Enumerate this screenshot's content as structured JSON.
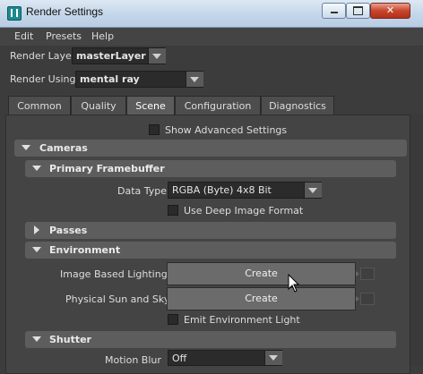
{
  "window": {
    "title": "Render Settings"
  },
  "menu": [
    "Edit",
    "Presets",
    "Help"
  ],
  "render_layer": {
    "label": "Render Layer",
    "value": "masterLayer"
  },
  "render_using": {
    "label": "Render Using",
    "value": "mental ray"
  },
  "tabs": [
    {
      "label": "Common",
      "active": false
    },
    {
      "label": "Quality",
      "active": false
    },
    {
      "label": "Scene",
      "active": true
    },
    {
      "label": "Configuration",
      "active": false
    },
    {
      "label": "Diagnostics",
      "active": false
    }
  ],
  "show_advanced": {
    "label": "Show Advanced Settings",
    "checked": false
  },
  "sections": {
    "cameras": {
      "label": "Cameras",
      "expanded": true
    },
    "primary_framebuffer": {
      "label": "Primary Framebuffer",
      "expanded": true
    },
    "passes": {
      "label": "Passes",
      "expanded": false
    },
    "environment": {
      "label": "Environment",
      "expanded": true
    },
    "shutter": {
      "label": "Shutter",
      "expanded": true
    }
  },
  "data_type": {
    "label": "Data Type",
    "value": "RGBA (Byte)  4x8 Bit"
  },
  "deep_image": {
    "label": "Use Deep Image Format",
    "checked": false
  },
  "ibl": {
    "label": "Image Based Lighting",
    "button": "Create"
  },
  "sun_sky": {
    "label": "Physical Sun and Sky",
    "button": "Create"
  },
  "emit_env": {
    "label": "Emit Environment Light",
    "checked": false
  },
  "motion_blur": {
    "label": "Motion Blur",
    "value": "Off"
  },
  "window_controls": {
    "close_glyph": "✕"
  }
}
